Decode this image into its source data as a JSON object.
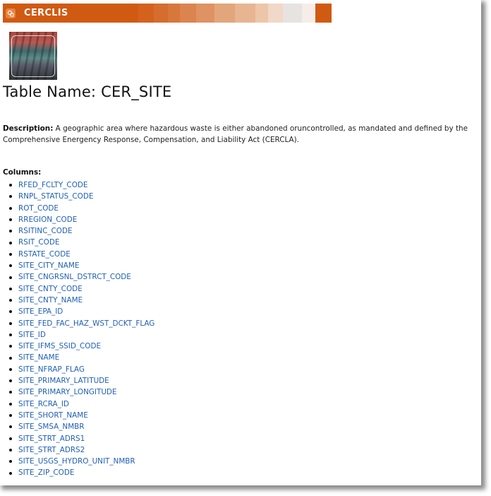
{
  "header": {
    "title": "CERCLIS",
    "icon": "search-document-icon",
    "color": "#D15A12",
    "fade_colors": [
      "#D4621E",
      "#D56D2E",
      "#D8773C",
      "#DB8450",
      "#DF9263",
      "#E3A67C",
      "#E8B593",
      "#EDC6AA",
      "#F1D8C8",
      "#E6E3E1",
      "#F7EDE8"
    ]
  },
  "thumbnail": {
    "alt": "Stacked waste drums"
  },
  "page": {
    "title": "Table Name: CER_SITE",
    "description_label": "Description:",
    "description_text": " A geographic area where hazardous waste is either abandoned oruncontrolled, as mandated and defined by the Comprehensive Energency Response, Compensation, and Liability Act (CERCLA).",
    "columns_label": "Columns:"
  },
  "columns": [
    "RFED_FCLTY_CODE",
    "RNPL_STATUS_CODE",
    "ROT_CODE",
    "RREGION_CODE",
    "RSITINC_CODE",
    "RSIT_CODE",
    "RSTATE_CODE",
    "SITE_CITY_NAME",
    "SITE_CNGRSNL_DSTRCT_CODE",
    "SITE_CNTY_CODE",
    "SITE_CNTY_NAME",
    "SITE_EPA_ID",
    "SITE_FED_FAC_HAZ_WST_DCKT_FLAG",
    "SITE_ID",
    "SITE_IFMS_SSID_CODE",
    "SITE_NAME",
    "SITE_NFRAP_FLAG",
    "SITE_PRIMARY_LATITUDE",
    "SITE_PRIMARY_LONGITUDE",
    "SITE_RCRA_ID",
    "SITE_SHORT_NAME",
    "SITE_SMSA_NMBR",
    "SITE_STRT_ADRS1",
    "SITE_STRT_ADRS2",
    "SITE_USGS_HYDRO_UNIT_NMBR",
    "SITE_ZIP_CODE"
  ]
}
